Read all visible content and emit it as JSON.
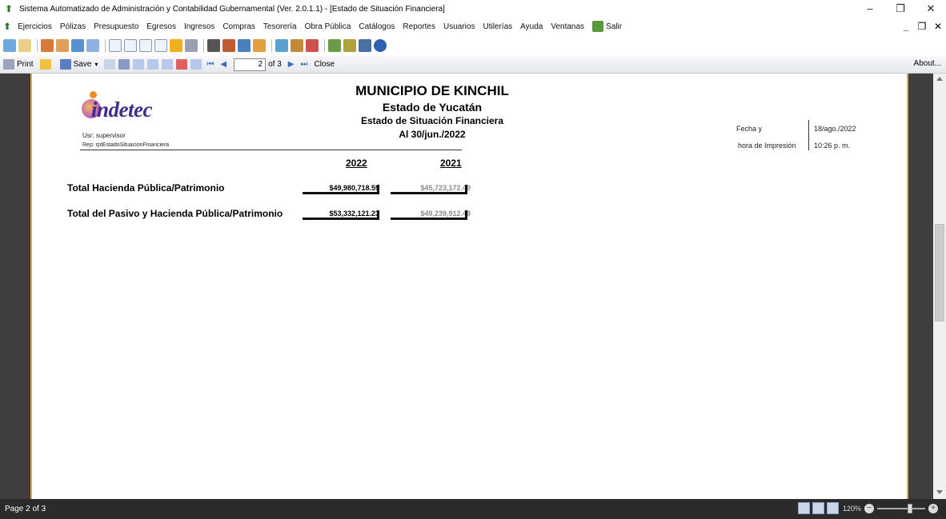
{
  "window": {
    "title": "Sistema Automatizado de Administración y Contabilidad Gubernamental  (Ver. 2.0.1.1) - [Estado de Situación Financiera]",
    "minimize": "–",
    "restore": "❐",
    "close": "✕"
  },
  "menu": {
    "items": [
      "Ejercicios",
      "Pólizas",
      "Presupuesto",
      "Egresos",
      "Ingresos",
      "Compras",
      "Tesorería",
      "Obra Pública",
      "Catálogos",
      "Reportes",
      "Usuarios",
      "Utilerías",
      "Ayuda",
      "Ventanas",
      "Salir"
    ],
    "mdi_min": "_",
    "mdi_restore": "❐",
    "mdi_close": "✕"
  },
  "viewer": {
    "print": "Print",
    "save": "Save",
    "page_value": "2",
    "page_of": "of 3",
    "close": "Close",
    "about": "About..."
  },
  "report": {
    "logo_text": "indetec",
    "usr": "Usr: supervisor",
    "rep": "Rep: rptEstadoSituacionFinanciera",
    "title1": "MUNICIPIO DE KINCHIL",
    "title2": "Estado de Yucatán",
    "title3": "Estado de Situación Financiera",
    "title4": "Al 30/jun./2022",
    "fecha_label": "Fecha y",
    "fecha_value": "18/ago./2022",
    "hora_label": "hora de Impresión",
    "hora_value": "10:26 p. m.",
    "year1": "2022",
    "year2": "2021",
    "rows": [
      {
        "label": "Total Hacienda Pública/Patrimonio",
        "v2022": "$49,980,718.59",
        "v2021": "$45,723,172.49"
      },
      {
        "label": "Total del Pasivo y Hacienda Pública/Patrimonio",
        "v2022": "$53,332,121.23",
        "v2021": "$49,239,912.48"
      }
    ]
  },
  "status": {
    "page_text": "Page 2 of 3",
    "zoom": "120%"
  },
  "colors": {
    "page_border": "#e6a93a",
    "viewport_bg": "#3e3e3e",
    "status_bg": "#2b2b2b",
    "logo_purple": "#3f2c8c"
  }
}
